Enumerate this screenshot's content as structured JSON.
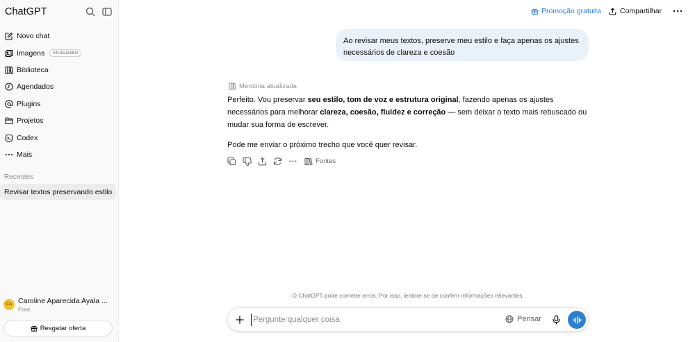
{
  "sidebar": {
    "brand": "ChatGPT",
    "items": [
      {
        "label": "Novo chat",
        "icon": "new-chat-icon"
      },
      {
        "label": "Imagens",
        "icon": "images-icon",
        "badge": "ATUALIZADO"
      },
      {
        "label": "Biblioteca",
        "icon": "library-icon"
      },
      {
        "label": "Agendados",
        "icon": "clock-icon"
      },
      {
        "label": "Plugins",
        "icon": "at-icon"
      },
      {
        "label": "Projetos",
        "icon": "folder-icon"
      },
      {
        "label": "Codex",
        "icon": "codex-icon"
      },
      {
        "label": "Mais",
        "icon": "more-icon"
      }
    ],
    "recent_title": "Recentes",
    "recent_items": [
      {
        "label": "Revisar textos preservando estilo"
      }
    ],
    "user": {
      "name": "Caroline Aparecida Ayala ...",
      "initials": "CA",
      "plan": "Free"
    },
    "offer_label": "Resgatar oferta"
  },
  "header": {
    "promo_label": "Promoção gratuita",
    "share_label": "Compartilhar"
  },
  "chat": {
    "user_message": "Ao revisar meus textos, preserve meu estilo e faça apenas os ajustes necessários de clareza e coesão",
    "memory_label": "Memória atualizada",
    "answer": {
      "p1_a": "Perfeito. Vou preservar ",
      "p1_b": "seu estilo, tom de voz e estrutura original",
      "p1_c": ", fazendo apenas os ajustes necessários para melhorar ",
      "p1_d": "clareza, coesão, fluidez e correção",
      "p1_e": " — sem deixar o texto mais rebuscado ou mudar sua forma de escrever.",
      "p2": "Pode me enviar o próximo trecho que você quer revisar."
    },
    "sources_label": "Fontes"
  },
  "footer": {
    "disclaimer": "O ChatGPT pode cometer erros. Por isso, lembre-se de conferir informações relevantes."
  },
  "composer": {
    "placeholder": "Pergunte qualquer coisa",
    "think_label": "Pensar"
  },
  "colors": {
    "accent": "#2f7fd1",
    "user_bubble": "#e9f1fb",
    "sidebar_bg": "#f9f9f9"
  }
}
